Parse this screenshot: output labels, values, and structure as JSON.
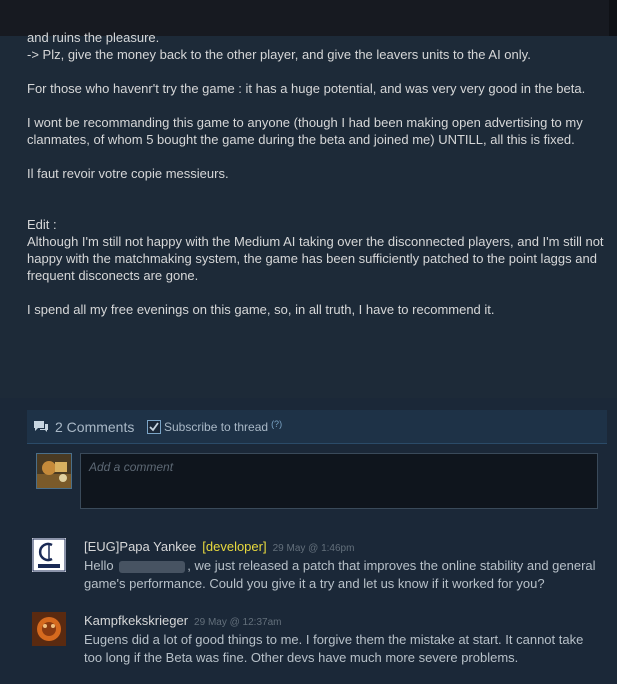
{
  "review": {
    "lines": [
      "and ruins the pleasure.",
      "-> Plz, give the money back to the other player, and give the leavers units to the AI only.",
      "For those who havenr't try the game : it has a huge potential, and was very very good in the beta.",
      "I wont be recommanding this game to anyone (though I had been making open advertising to my clanmates, of whom 5 bought the game during the beta and joined me) UNTILL, all this is fixed.",
      "Il faut revoir votre copie messieurs.",
      "Edit :",
      "Although I'm still not happy with the Medium AI taking over the disconnected players, and I'm still not happy with the matchmaking system, the game has been sufficiently patched to the point laggs and frequent disconects are gone.",
      "I spend all my free evenings on this game, so, in all truth, I have to recommend it."
    ]
  },
  "comments_header": {
    "count_label": "2 Comments",
    "subscribe_label": "Subscribe to thread",
    "help_label": "(?)"
  },
  "comment_input": {
    "placeholder": "Add a comment"
  },
  "comments": [
    {
      "author": "[EUG]Papa Yankee",
      "badge": "[developer]",
      "time": "29 May @ 1:46pm",
      "text_before": "Hello",
      "text_after": ", we just released a patch that improves the online stability and general game's performance. Could you give it a try and let us know if it worked for you?"
    },
    {
      "author": "Kampfkekskrieger",
      "time": "29 May @ 12:37am",
      "text": "Eugens did a lot of good things to me. I forgive them the mistake at start. It cannot take too long if the Beta was fine. Other devs have much more severe problems."
    }
  ],
  "colors": {
    "background": "#1b2838",
    "review_panel": "#1d2a38",
    "header_panel": "#1e3247",
    "developer_badge": "#e8d93e"
  },
  "icons": [
    "chat-bubble-icon",
    "checkbox-check-icon",
    "eugen-logo-avatar",
    "user-avatar"
  ]
}
